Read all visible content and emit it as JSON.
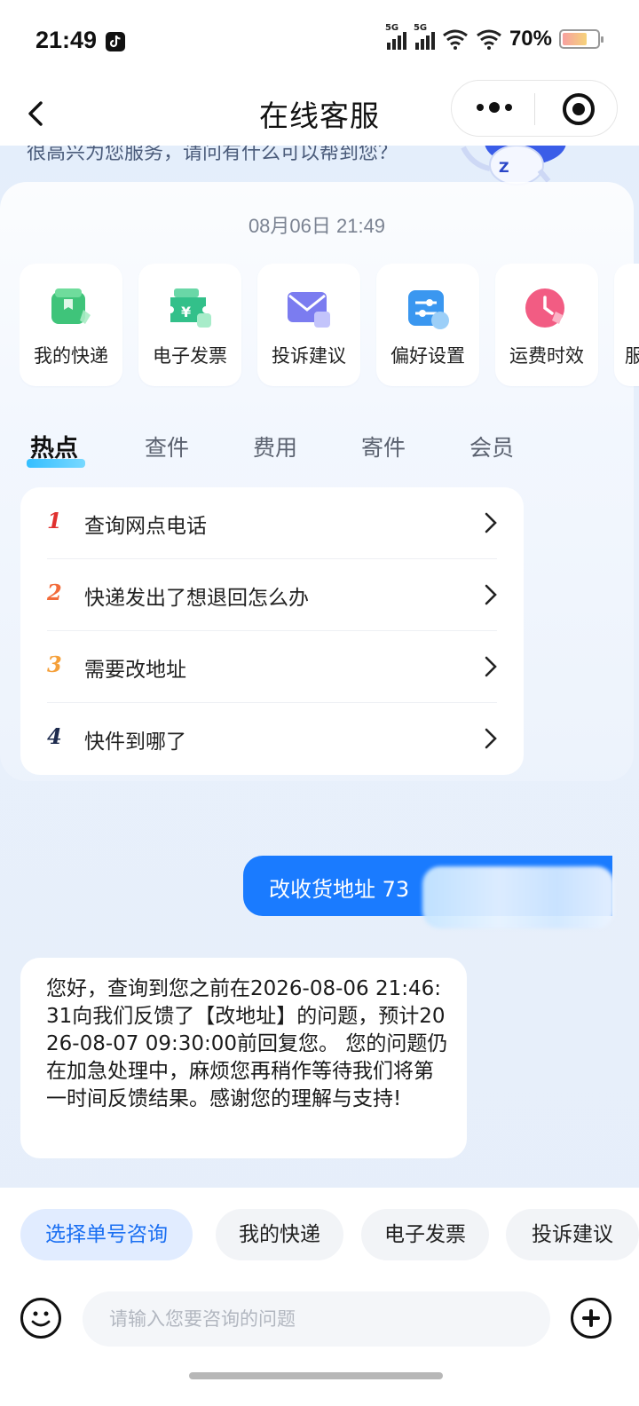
{
  "status_bar": {
    "time": "21:49",
    "signal_1_label": "5G",
    "signal_2_label": "5G",
    "battery_percent": "70%"
  },
  "nav": {
    "title": "在线客服"
  },
  "banner": {
    "text": "很高兴为您服务，请问有什么可以帮到您？"
  },
  "chat": {
    "date": "08月06日 21:49",
    "quick_entries": [
      {
        "label": "我的快递",
        "icon": "package-icon",
        "color": "#3fc47a"
      },
      {
        "label": "电子发票",
        "icon": "invoice-icon",
        "color": "#33c08a"
      },
      {
        "label": "投诉建议",
        "icon": "mail-icon",
        "color": "#7b7cf0"
      },
      {
        "label": "偏好设置",
        "icon": "settings-sliders-icon",
        "color": "#3a97f0"
      },
      {
        "label": "运费时效",
        "icon": "clock-icon",
        "color": "#f25c83"
      },
      {
        "label": "服",
        "icon": "service-icon",
        "color": "#3a97f0"
      }
    ],
    "tabs": [
      "热点",
      "查件",
      "费用",
      "寄件",
      "会员"
    ],
    "active_tab": "热点",
    "faq": [
      {
        "num": "1",
        "text": "查询网点电话",
        "color": "#e0312f"
      },
      {
        "num": "2",
        "text": "快递发出了想退回怎么办",
        "color": "#f26b3a"
      },
      {
        "num": "3",
        "text": "需要改地址",
        "color": "#f5a03a"
      },
      {
        "num": "4",
        "text": "快件到哪了",
        "color": "#1d2a4d"
      }
    ],
    "user_message": "改收货地址 73",
    "bot_message": "您好，查询到您之前在2026-08-06 21:46:31向我们反馈了【改地址】的问题，预计2026-08-07 09:30:00前回复您。 您的问题仍在加急处理中，麻烦您再稍作等待我们将第一时间反馈结果。感谢您的理解与支持!"
  },
  "bottom": {
    "chips": [
      "选择单号咨询",
      "我的快递",
      "电子发票",
      "投诉建议"
    ],
    "input_placeholder": "请输入您要咨询的问题",
    "accent_color": "#1a7bff"
  }
}
